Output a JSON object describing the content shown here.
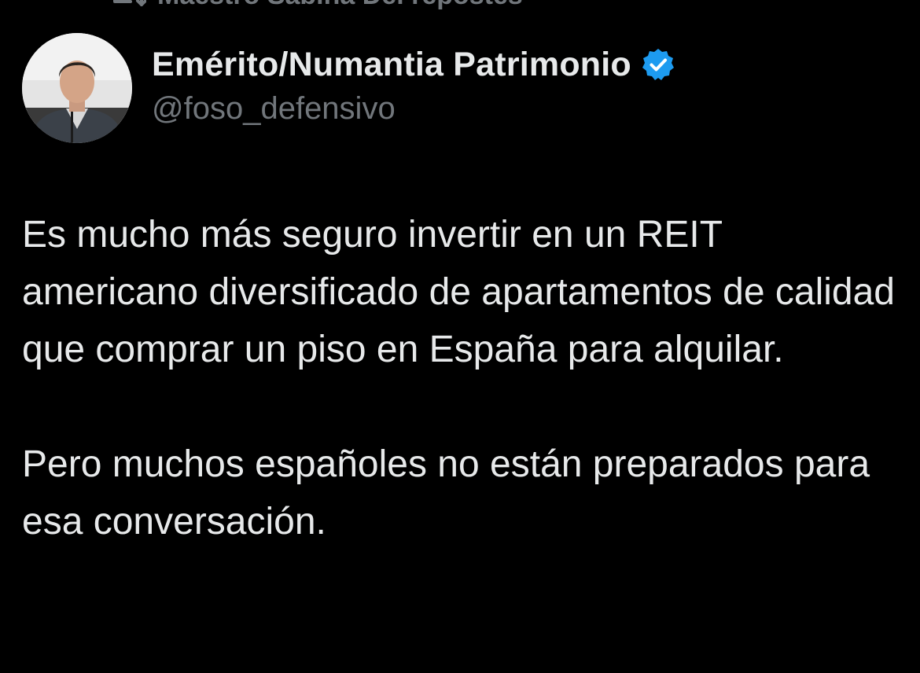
{
  "repost": {
    "text": "Maestro Sabina Del repostes",
    "icon": "repost-icon"
  },
  "author": {
    "display_name": "Emérito/Numantia Patrimonio",
    "handle": "@foso_defensivo",
    "verified_icon": "verified-badge-icon",
    "avatar": "avatar"
  },
  "tweet": {
    "paragraphs": [
      "Es mucho más seguro invertir en un REIT americano diversificado de apartamentos de calidad que comprar un piso en España para alquilar.",
      "Pero muchos españoles no están preparados para esa conversación."
    ]
  },
  "colors": {
    "background": "#000000",
    "text_primary": "#e7e9ea",
    "text_secondary": "#71767b",
    "verified_blue": "#1d9bf0"
  }
}
